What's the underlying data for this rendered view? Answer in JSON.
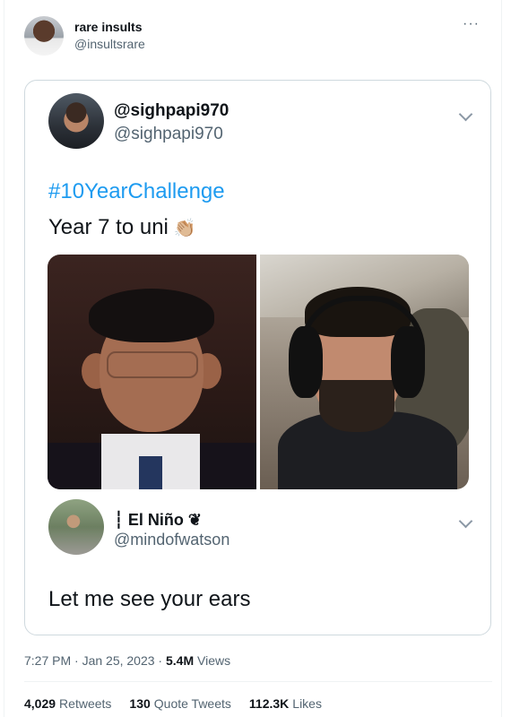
{
  "tweet": {
    "author_name": "rare insults",
    "author_handle": "@insultsrare",
    "more_icon": "more-icon",
    "timestamp": "7:27 PM · Jan 25, 2023",
    "views_count": "5.4M",
    "views_label": "Views"
  },
  "quoted": {
    "name": "@sighpapi970",
    "handle": "@sighpapi970",
    "hashtag": "#10YearChallenge",
    "text": "Year 7 to uni",
    "emoji": "👏🏼",
    "photos": [
      "photo-before",
      "photo-after"
    ]
  },
  "reply": {
    "name": "┆ El Niño ❦",
    "handle": "@mindofwatson",
    "text": "Let me see your ears"
  },
  "stats": {
    "retweets_count": "4,029",
    "retweets_label": "Retweets",
    "quotes_count": "130",
    "quotes_label": "Quote Tweets",
    "likes_count": "112.3K",
    "likes_label": "Likes"
  },
  "colors": {
    "link": "#1d9bf0",
    "secondary": "#536471",
    "border": "#cfd9de"
  }
}
